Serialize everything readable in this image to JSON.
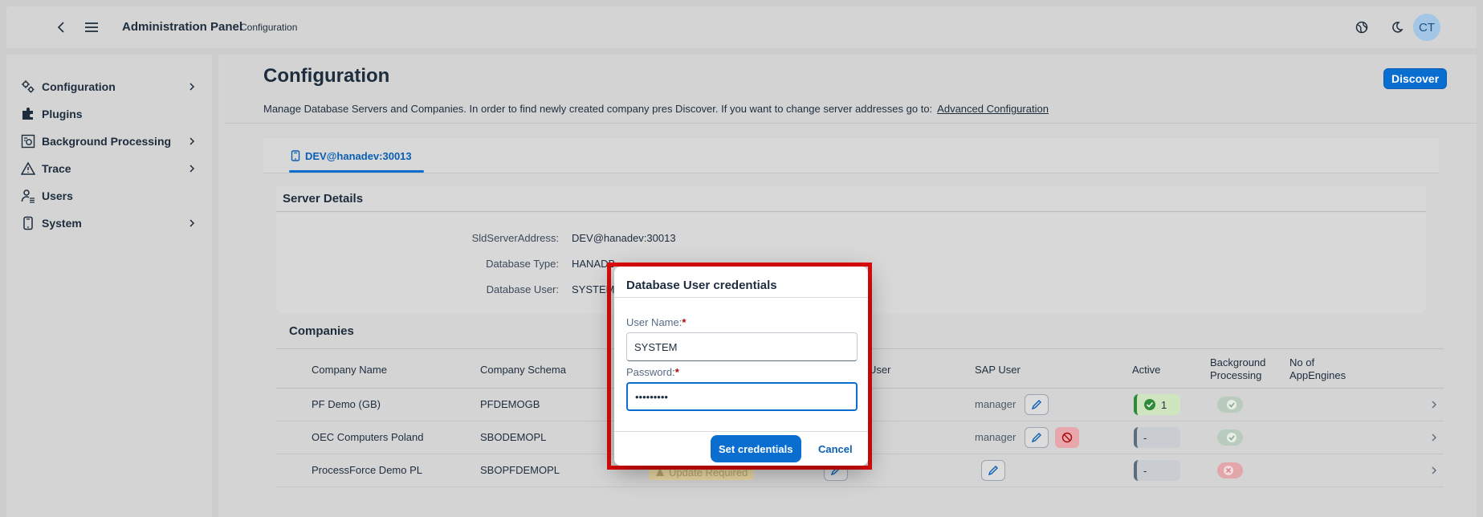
{
  "header": {
    "title": "Administration Panel",
    "subtitle": "Configuration",
    "avatar_initials": "CT"
  },
  "sidebar": {
    "items": [
      {
        "label": "Configuration",
        "icon": "gears-icon",
        "has_children": true
      },
      {
        "label": "Plugins",
        "icon": "puzzle-icon",
        "has_children": false
      },
      {
        "label": "Background Processing",
        "icon": "process-icon",
        "has_children": true
      },
      {
        "label": "Trace",
        "icon": "warning-icon",
        "has_children": true
      },
      {
        "label": "Users",
        "icon": "user-list-icon",
        "has_children": false
      },
      {
        "label": "System",
        "icon": "device-icon",
        "has_children": true
      }
    ]
  },
  "page": {
    "title": "Configuration",
    "discover_label": "Discover",
    "description": "Manage Database Servers and Companies. In order to find newly created company pres Discover. If you want to change server addresses go to:",
    "advanced_link": "Advanced Configuration",
    "tab_label": "DEV@hanadev:30013"
  },
  "server_details": {
    "title": "Server Details",
    "fields": [
      {
        "label": "SldServerAddress:",
        "value": "DEV@hanadev:30013"
      },
      {
        "label": "Database Type:",
        "value": "HANADB"
      },
      {
        "label": "Database User:",
        "value": "SYSTEM"
      }
    ]
  },
  "companies": {
    "title": "Companies",
    "columns": {
      "name": "Company Name",
      "schema": "Company Schema",
      "db_user": "User",
      "sap_user": "SAP User",
      "active": "Active",
      "bg_proc_1": "Background",
      "bg_proc_2": "Processing",
      "appengines_1": "No of",
      "appengines_2": "AppEngines"
    },
    "rows": [
      {
        "name": "PF Demo (GB)",
        "schema": "PFDEMOGB",
        "sap_user": "manager",
        "appengines": "1"
      },
      {
        "name": "OEC Computers Poland",
        "schema": "SBODEMOPL",
        "sap_user": "manager",
        "appengines": "-"
      },
      {
        "name": "ProcessForce Demo PL",
        "schema": "SBOPFDEMOPL",
        "sap_user": "",
        "appengines": "-",
        "status": "Update Required"
      }
    ]
  },
  "dialog": {
    "title": "Database User credentials",
    "username_label": "User Name:",
    "username_value": "SYSTEM",
    "password_label": "Password:",
    "password_value": "•••••••••",
    "required_mark": "*",
    "submit_label": "Set credentials",
    "cancel_label": "Cancel"
  },
  "colors": {
    "accent": "#0a6ed1",
    "highlight_frame": "#e10b0b",
    "success": "#2f8a3a",
    "error": "#c8353a"
  }
}
